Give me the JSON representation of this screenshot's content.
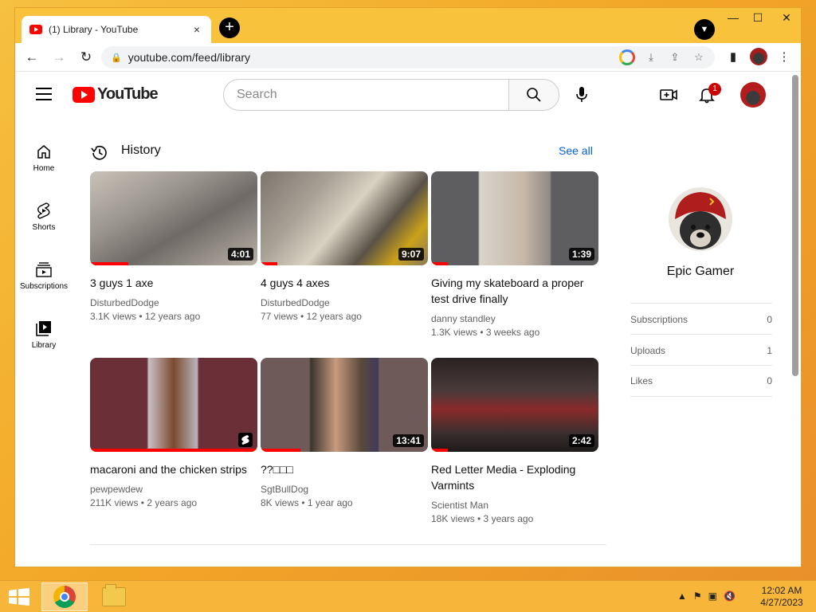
{
  "browser": {
    "tab_title": "(1) Library - YouTube",
    "tab_close": "×",
    "new_tab": "+",
    "url": "youtube.com/feed/library"
  },
  "yt": {
    "logo_text": "YouTube",
    "search_placeholder": "Search",
    "notification_count": "1"
  },
  "guide": [
    {
      "label": "Home",
      "icon": "home-icon"
    },
    {
      "label": "Shorts",
      "icon": "shorts-icon"
    },
    {
      "label": "Subscriptions",
      "icon": "subscriptions-icon"
    },
    {
      "label": "Library",
      "icon": "library-icon"
    }
  ],
  "history": {
    "title": "History",
    "see_all": "See all",
    "videos": [
      {
        "title": "3 guys 1 axe",
        "channel": "DisturbedDodge",
        "meta": "3.1K views • 12 years ago",
        "duration": "4:01",
        "progress": 0.23
      },
      {
        "title": "4 guys 4 axes",
        "channel": "DisturbedDodge",
        "meta": "77 views • 12 years ago",
        "duration": "9:07",
        "progress": 0.1
      },
      {
        "title": "Giving my skateboard a proper test drive finally",
        "channel": "danny standley",
        "meta": "1.3K views • 3 weeks ago",
        "duration": "1:39",
        "progress": 0.1
      },
      {
        "title": "macaroni and the chicken strips",
        "channel": "pewpewdew",
        "meta": "211K views • 2 years ago",
        "duration": "",
        "progress": 1.0
      },
      {
        "title": "??□□□",
        "channel": "SgtBullDog",
        "meta": "8K views • 1 year ago",
        "duration": "13:41",
        "progress": 0.24
      },
      {
        "title": "Red Letter Media - Exploding Varmints",
        "channel": "Scientist Man",
        "meta": "18K views • 3 years ago",
        "duration": "2:42",
        "progress": 0.1
      }
    ]
  },
  "profile": {
    "name": "Epic Gamer",
    "stats": [
      {
        "label": "Subscriptions",
        "value": "0"
      },
      {
        "label": "Uploads",
        "value": "1"
      },
      {
        "label": "Likes",
        "value": "0"
      }
    ]
  },
  "taskbar": {
    "time": "12:02 AM",
    "date": "4/27/2023"
  }
}
